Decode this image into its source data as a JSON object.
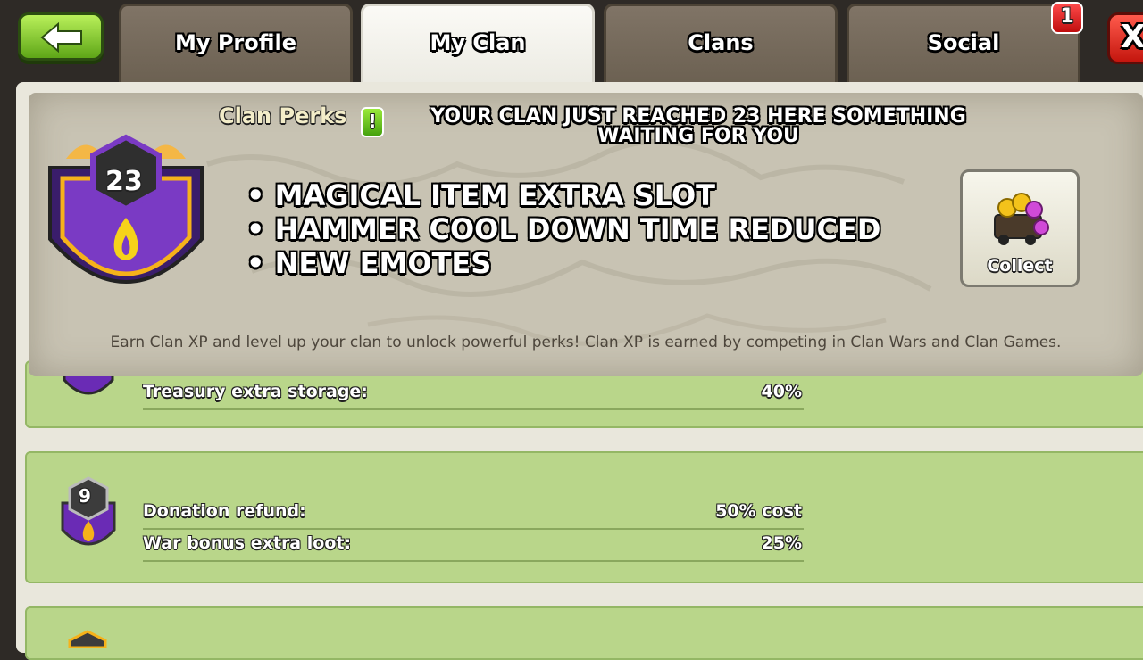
{
  "tabs": [
    {
      "label": "My Profile"
    },
    {
      "label": "My Clan",
      "active": true
    },
    {
      "label": "Clans"
    },
    {
      "label": "Social"
    }
  ],
  "notification_badge": "1",
  "close_label": "X",
  "banner": {
    "title": "Clan Perks",
    "info_label": "!",
    "headline": "YOUR CLAN JUST REACHED 23 HERE SOMETHING WAITING FOR YOU",
    "clan_level": "23",
    "bullets": [
      "• MAGICAL ITEM EXTRA  SLOT",
      "• HAMMER COOL DOWN TIME REDUCED",
      "• NEW EMOTES"
    ],
    "collect_label": "Collect",
    "footer": "Earn Clan XP and level up your clan to unlock powerful perks! Clan XP is earned by competing in Clan Wars and Clan Games."
  },
  "perk_rows": [
    {
      "items": [
        {
          "label": "Treasury extra storage:",
          "value": "40%"
        }
      ]
    },
    {
      "level": "9",
      "items": [
        {
          "label": "Donation refund:",
          "value": "50% cost"
        },
        {
          "label": "War bonus extra loot:",
          "value": "25%"
        }
      ]
    }
  ],
  "colors": {
    "tab_active": "#f6f5ef",
    "tab_inactive": "#776c5e",
    "row_green": "#b9d68a",
    "badge_purple": "#6a2bb5",
    "badge_gold": "#f6b21a",
    "button_green": "#7cc52b",
    "close_red": "#e1291c"
  },
  "icons": [
    "back-arrow-icon",
    "close-icon",
    "clan-badge-icon",
    "loot-cart-icon",
    "info-icon"
  ]
}
